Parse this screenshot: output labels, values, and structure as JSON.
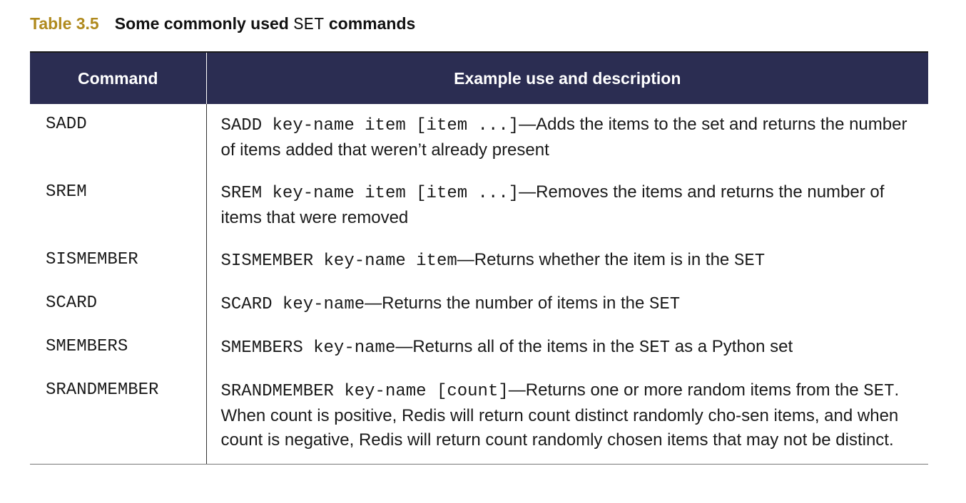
{
  "caption": {
    "number": "Table 3.5",
    "title_prefix": "Some commonly used",
    "title_code": "SET",
    "title_suffix": "commands"
  },
  "table": {
    "headers": [
      "Command",
      "Example use and description"
    ],
    "rows": [
      {
        "command": "SADD",
        "example": "SADD key-name item [item ...]",
        "description": "—Adds the items to the set and returns the number of items added that weren’t already present"
      },
      {
        "command": "SREM",
        "example": "SREM key-name item [item ...]",
        "description": "—Removes the items and returns the number of items that were removed"
      },
      {
        "command": "SISMEMBER",
        "example": "SISMEMBER key-name item",
        "description": "—Returns whether the item is in the",
        "code_after": "SET"
      },
      {
        "command": "SCARD",
        "example": "SCARD key-name",
        "description": "—Returns the number of items in the",
        "code_after": "SET"
      },
      {
        "command": "SMEMBERS",
        "example": "SMEMBERS key-name",
        "description": "—Returns all of the items in the",
        "code_after": "SET",
        "description_after": "as a Python set"
      },
      {
        "command": "SRANDMEMBER",
        "example": "SRANDMEMBER key-name [count]",
        "description": "—Returns one or more random items from the",
        "code_after": "SET",
        "description_after": ". When count is positive, Redis will return count distinct randomly cho-sen items, and when count is negative, Redis will return count randomly chosen items that may not be distinct."
      }
    ]
  }
}
